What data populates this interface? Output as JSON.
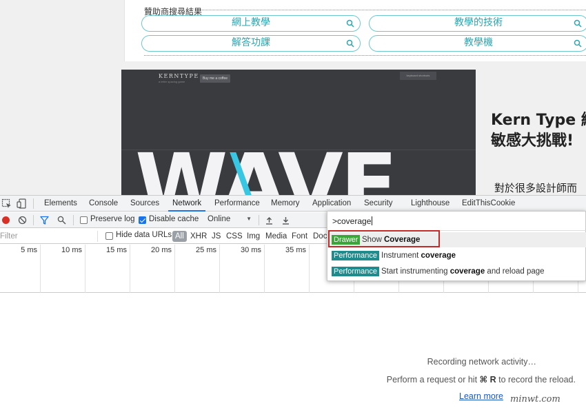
{
  "sponsor": {
    "title": "贊助商搜尋結果",
    "pills": [
      "網上教學",
      "教學的技術",
      "解答功課",
      "教學機"
    ]
  },
  "banner": {
    "logo": "KERNTYPE",
    "subtitle": "a letter spacing game",
    "coffee_button": "Buy me a coffee",
    "shortcuts_button": "keyboard shortcuts",
    "big_word": "WAVE"
  },
  "article": {
    "title_line1": "Kern Type 線",
    "title_line2": "敏感大挑戰!",
    "body_start": "對於很多設計師而"
  },
  "devtools": {
    "tabs": [
      "Elements",
      "Console",
      "Sources",
      "Network",
      "Performance",
      "Memory",
      "Application",
      "Security",
      "Lighthouse",
      "EditThisCookie"
    ],
    "active_tab": "Network",
    "toolbar": {
      "preserve_log": "Preserve log",
      "preserve_log_checked": false,
      "disable_cache": "Disable cache",
      "disable_cache_checked": true,
      "throttling": "Online"
    },
    "filter_placeholder": "Filter",
    "hide_data_urls": "Hide data URLs",
    "types": [
      "All",
      "XHR",
      "JS",
      "CSS",
      "Img",
      "Media",
      "Font",
      "Doc"
    ],
    "active_type": "All",
    "timeline_ticks": [
      "5 ms",
      "10 ms",
      "15 ms",
      "20 ms",
      "25 ms",
      "30 ms",
      "35 ms"
    ],
    "empty_state": {
      "title": "Recording network activity…",
      "hint_prefix": "Perform a request or hit ",
      "hint_shortcut": "⌘ R",
      "hint_suffix": " to record the reload.",
      "learn_more": "Learn more"
    },
    "command_menu": {
      "query": ">coverage",
      "items": [
        {
          "badge": "Drawer",
          "badge_color": "#3aa538",
          "prefix": "Show ",
          "match": "Coverage",
          "suffix": ""
        },
        {
          "badge": "Performance",
          "badge_color": "#1f8b8d",
          "prefix": "Instrument ",
          "match": "coverage",
          "suffix": ""
        },
        {
          "badge": "Performance",
          "badge_color": "#1f8b8d",
          "prefix": "Start instrumenting ",
          "match": "coverage",
          "suffix": " and reload page"
        }
      ]
    }
  },
  "watermark": "minwt.com"
}
